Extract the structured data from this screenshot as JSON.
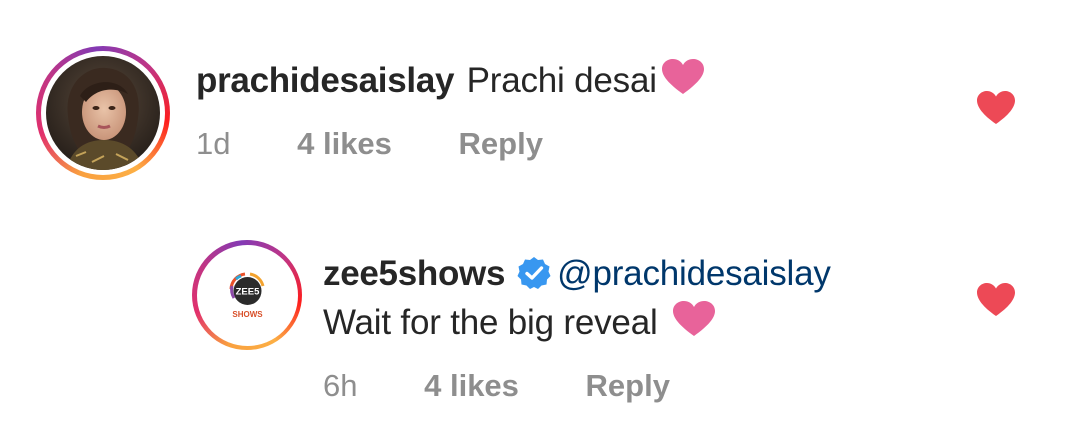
{
  "comments": [
    {
      "username": "prachidesaislay",
      "text": "Prachi desai",
      "time": "1d",
      "likes": "4 likes",
      "reply_label": "Reply",
      "liked": true
    },
    {
      "username": "zee5shows",
      "verified": true,
      "mention": "@prachidesaislay",
      "text": "Wait for the big reveal",
      "time": "6h",
      "likes": "4 likes",
      "reply_label": "Reply",
      "liked": true,
      "avatar_logo": {
        "brand": "ZEE5",
        "sub": "SHOWS"
      }
    }
  ],
  "colors": {
    "like_heart": "#ed4956",
    "emoji_heart": "#e8639a",
    "verified_badge": "#3897f0",
    "mention": "#00376b",
    "meta_text": "#8e8e8e"
  },
  "icons": {
    "like": "heart-icon",
    "emoji": "pink-heart-emoji",
    "verified": "verified-badge-icon"
  }
}
